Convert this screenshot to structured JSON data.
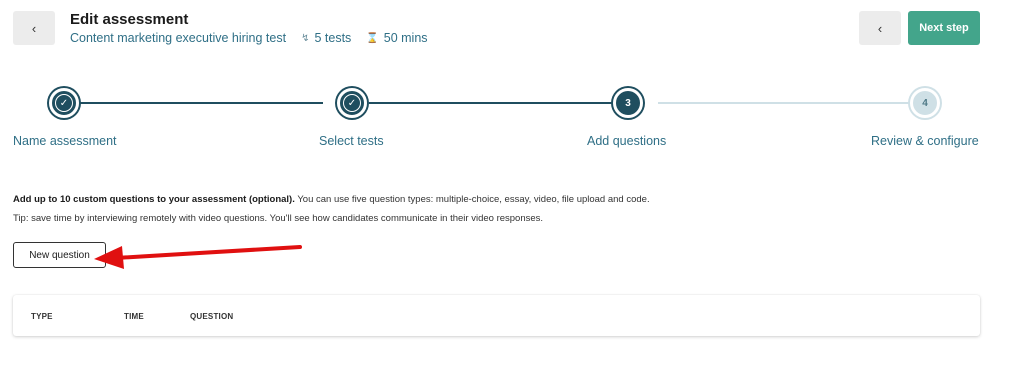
{
  "header": {
    "back_icon": "chevron-left-icon",
    "title": "Edit assessment",
    "test_name": "Content marketing executive hiring test",
    "tests_count": "5 tests",
    "tests_icon": "bolt-icon",
    "duration": "50 mins",
    "duration_icon": "hourglass-icon",
    "next_label": "Next step",
    "accent_color": "#43a58b"
  },
  "stepper": {
    "steps": [
      {
        "label": "Name assessment",
        "state": "done",
        "number": ""
      },
      {
        "label": "Select tests",
        "state": "done",
        "number": ""
      },
      {
        "label": "Add questions",
        "state": "current",
        "number": "3"
      },
      {
        "label": "Review & configure",
        "state": "future",
        "number": "4"
      }
    ],
    "active_color": "#1f4e5f",
    "inactive_color": "#cfe0e6"
  },
  "intro": {
    "bold": "Add up to 10 custom questions to your assessment (optional).",
    "rest": " You can use five question types: multiple-choice, essay, video, file upload and code.",
    "tip": "Tip: save time by interviewing remotely with video questions. You'll see how candidates communicate in their video responses."
  },
  "new_question_label": "New question",
  "table": {
    "columns": [
      "TYPE",
      "TIME",
      "QUESTION"
    ]
  }
}
